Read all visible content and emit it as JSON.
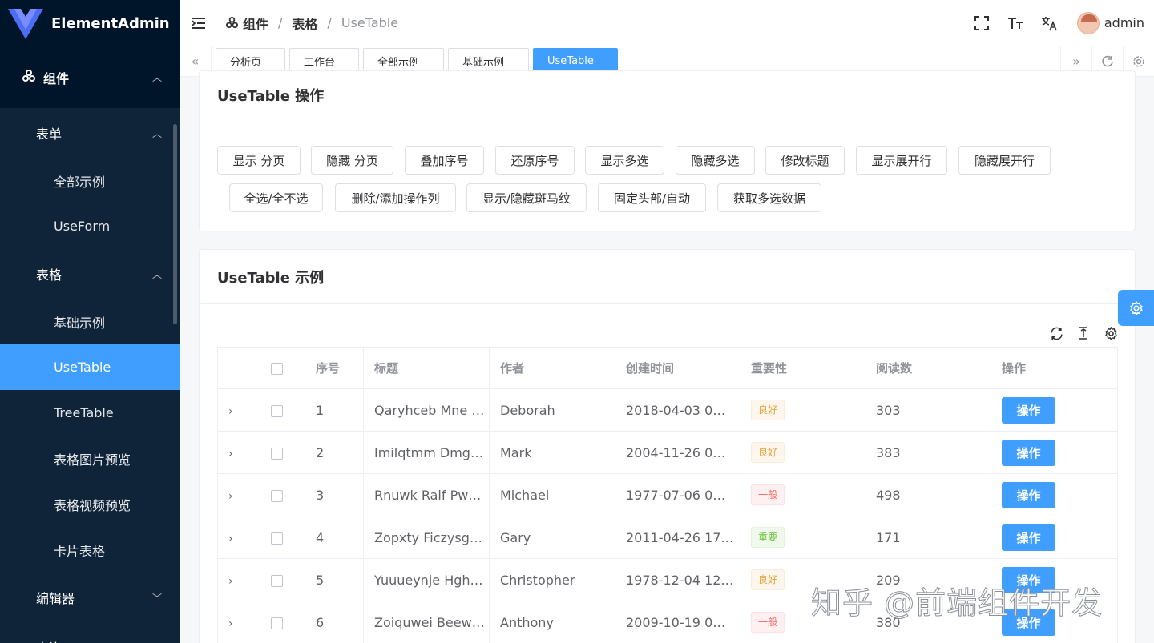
{
  "app": {
    "name": "ElementAdmin"
  },
  "sidebar": {
    "top": {
      "label": "组件",
      "icon": "component-icon"
    },
    "groups": [
      {
        "label": "表单",
        "items": [
          "全部示例",
          "UseForm"
        ]
      },
      {
        "label": "表格",
        "items": [
          "基础示例",
          "UseTable",
          "TreeTable",
          "表格图片预览",
          "表格视频预览",
          "卡片表格"
        ]
      },
      {
        "label": "编辑器"
      }
    ],
    "next_item": "查询",
    "active_item": "UseTable"
  },
  "header": {
    "breadcrumb": [
      "组件",
      "表格",
      "UseTable"
    ],
    "username": "admin"
  },
  "tags": [
    "分析页",
    "工作台",
    "全部示例",
    "基础示例",
    "UseTable"
  ],
  "active_tag": "UseTable",
  "ops_card": {
    "title": "UseTable 操作",
    "buttons_row1": [
      "显示 分页",
      "隐藏 分页",
      "叠加序号",
      "还原序号",
      "显示多选",
      "隐藏多选",
      "修改标题",
      "显示展开行",
      "隐藏展开行"
    ],
    "buttons_row2": [
      "全选/全不选",
      "删除/添加操作列",
      "显示/隐藏斑马纹",
      "固定头部/自动",
      "获取多选数据"
    ]
  },
  "table_card": {
    "title": "UseTable 示例",
    "columns": [
      "序号",
      "标题",
      "作者",
      "创建时间",
      "重要性",
      "阅读数",
      "操作"
    ],
    "rows": [
      {
        "index": "1",
        "title": "Qaryhceb Mne …",
        "author": "Deborah",
        "time": "2018-04-03 0…",
        "importance": "良好",
        "level": "warning",
        "reads": "303",
        "action": "操作"
      },
      {
        "index": "2",
        "title": "Imilqtmm Dmg…",
        "author": "Mark",
        "time": "2004-11-26 0…",
        "importance": "良好",
        "level": "warning",
        "reads": "383",
        "action": "操作"
      },
      {
        "index": "3",
        "title": "Rnuwk Ralf Pw…",
        "author": "Michael",
        "time": "1977-07-06 0…",
        "importance": "一般",
        "level": "danger",
        "reads": "498",
        "action": "操作"
      },
      {
        "index": "4",
        "title": "Zopxty Ficzysg…",
        "author": "Gary",
        "time": "2011-04-26 17…",
        "importance": "重要",
        "level": "success",
        "reads": "171",
        "action": "操作"
      },
      {
        "index": "5",
        "title": "Yuuueynje Hgh…",
        "author": "Christopher",
        "time": "1978-12-04 12…",
        "importance": "良好",
        "level": "warning",
        "reads": "209",
        "action": "操作"
      },
      {
        "index": "6",
        "title": "Zoiquwei Beew…",
        "author": "Anthony",
        "time": "2009-10-19 0…",
        "importance": "一般",
        "level": "danger",
        "reads": "380",
        "action": "操作"
      }
    ]
  },
  "watermark": "知乎 @前端组件开发",
  "colors": {
    "primary": "#409eff",
    "sidebar_bg": "#001529",
    "warning": "#e6a23c",
    "danger": "#f56c6c",
    "success": "#67c23a"
  }
}
